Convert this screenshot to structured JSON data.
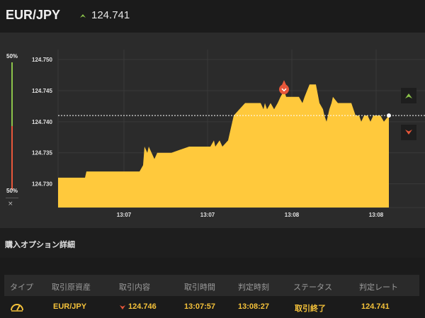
{
  "header": {
    "pair": "EUR/JPY",
    "price": "124.741",
    "trend": "up"
  },
  "sentiment": {
    "top_label": "50%",
    "bottom_label": "50%",
    "up_share": 0.5,
    "down_share": 0.5,
    "close_glyph": "×"
  },
  "chart_data": {
    "type": "area",
    "y_ticks": [
      "124.750",
      "124.745",
      "124.740",
      "124.735",
      "124.730"
    ],
    "x_ticks": [
      "13:07",
      "13:07",
      "13:08",
      "13:08"
    ],
    "ylim": [
      124.7262,
      124.7516
    ],
    "current_rate": 124.741,
    "entry_rate": 124.746,
    "grid": true,
    "points": [
      [
        0,
        124.731
      ],
      [
        38,
        124.731
      ],
      [
        40,
        124.732
      ],
      [
        115,
        124.732
      ],
      [
        120,
        124.733
      ],
      [
        122,
        124.736
      ],
      [
        126,
        124.735
      ],
      [
        128,
        124.736
      ],
      [
        132,
        124.735
      ],
      [
        136,
        124.734
      ],
      [
        140,
        124.735
      ],
      [
        160,
        124.735
      ],
      [
        185,
        124.736
      ],
      [
        200,
        124.736
      ],
      [
        215,
        124.736
      ],
      [
        220,
        124.737
      ],
      [
        222,
        124.736
      ],
      [
        228,
        124.737
      ],
      [
        232,
        124.736
      ],
      [
        240,
        124.737
      ],
      [
        244,
        124.739
      ],
      [
        248,
        124.741
      ],
      [
        256,
        124.742
      ],
      [
        264,
        124.743
      ],
      [
        286,
        124.743
      ],
      [
        290,
        124.742
      ],
      [
        292,
        124.743
      ],
      [
        295,
        124.742
      ],
      [
        300,
        124.743
      ],
      [
        305,
        124.742
      ],
      [
        310,
        124.743
      ],
      [
        314,
        124.744
      ],
      [
        319,
        124.745
      ],
      [
        322,
        124.744
      ],
      [
        340,
        124.744
      ],
      [
        345,
        124.743
      ],
      [
        348,
        124.744
      ],
      [
        355,
        124.746
      ],
      [
        364,
        124.746
      ],
      [
        369,
        124.743
      ],
      [
        374,
        124.742
      ],
      [
        376,
        124.741
      ],
      [
        379,
        124.74
      ],
      [
        383,
        124.742
      ],
      [
        386,
        124.743
      ],
      [
        388,
        124.744
      ],
      [
        395,
        124.743
      ],
      [
        414,
        124.743
      ],
      [
        420,
        124.741
      ],
      [
        425,
        124.741
      ],
      [
        428,
        124.74
      ],
      [
        432,
        124.741
      ],
      [
        437,
        124.741
      ],
      [
        441,
        124.74
      ],
      [
        445,
        124.741
      ],
      [
        455,
        124.741
      ],
      [
        460,
        124.74
      ],
      [
        467,
        124.741
      ]
    ]
  },
  "side_buttons": {
    "up": "up-arrow",
    "down": "down-arrow"
  },
  "section": {
    "title": "購入オプション詳細"
  },
  "table": {
    "headers": [
      "タイプ",
      "取引原資産",
      "取引内容",
      "取引時間",
      "判定時刻",
      "ステータス",
      "判定レート"
    ],
    "row": {
      "type_icon": "gauge-icon",
      "asset": "EUR/JPY",
      "direction": "down",
      "content": "124.746",
      "trade_time": "13:07:57",
      "judge_time": "13:08:27",
      "status": "取引終了",
      "judge_rate": "124.741"
    }
  },
  "colors": {
    "area": "#ffc93c",
    "up": "#8bc34a",
    "down": "#e8573a",
    "text_accent": "#f5c23a"
  }
}
